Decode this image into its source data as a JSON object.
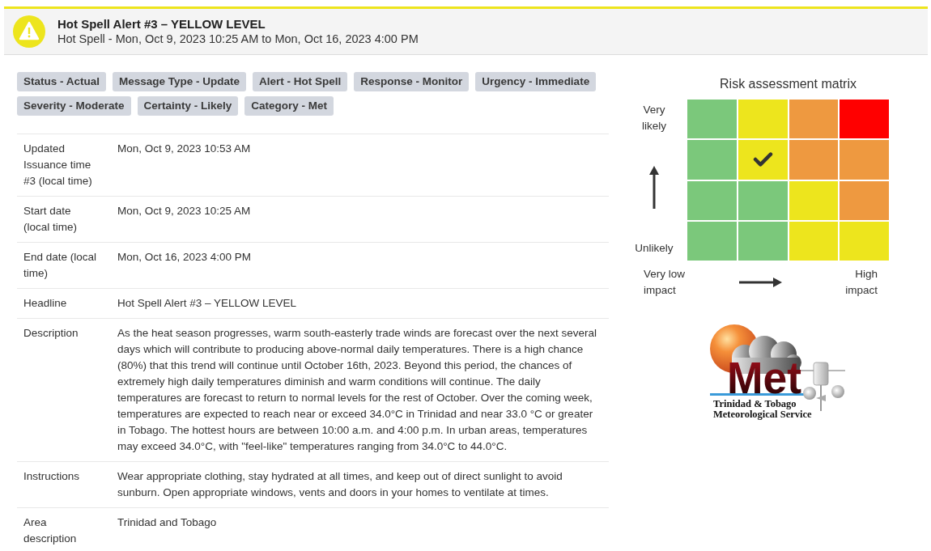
{
  "alert": {
    "title": "Hot Spell Alert #3 – YELLOW LEVEL",
    "subtitle": "Hot Spell - Mon, Oct 9, 2023 10:25 AM to Mon, Oct 16, 2023 4:00 PM"
  },
  "tags": [
    "Status - Actual",
    "Message Type - Update",
    "Alert - Hot Spell",
    "Response - Monitor",
    "Urgency - Immediate",
    "Severity - Moderate",
    "Certainty - Likely",
    "Category - Met"
  ],
  "details": [
    {
      "label": "Updated Issuance time #3 (local time)",
      "value": "Mon, Oct 9, 2023 10:53 AM"
    },
    {
      "label": "Start date (local time)",
      "value": "Mon, Oct 9, 2023 10:25 AM"
    },
    {
      "label": "End date (local time)",
      "value": "Mon, Oct 16, 2023 4:00 PM"
    },
    {
      "label": "Headline",
      "value": "Hot Spell Alert #3 – YELLOW LEVEL"
    },
    {
      "label": "Description",
      "value": "As the heat season progresses, warm south-easterly trade winds are forecast over the next several days which will contribute to producing above-normal daily temperatures. There is a high chance (80%) that this trend will continue until October 16th, 2023. Beyond this period, the chances of extremely high daily temperatures diminish and warm conditions will continue. The daily temperatures are forecast to return to normal levels for the rest of October. Over the coming week, temperatures are expected to reach near or exceed 34.0°C in Trinidad and near 33.0 °C or greater in Tobago. The hottest hours are between 10:00 a.m. and 4:00 p.m. In urban areas, temperatures may exceed 34.0°C, with \"feel-like\" temperatures ranging from 34.0°C to 44.0°C."
    },
    {
      "label": "Instructions",
      "value": "Wear appropriate clothing, stay hydrated at all times, and keep out of direct sunlight to avoid sunburn. Open appropriate windows, vents and doors in your homes to ventilate at times."
    },
    {
      "label": "Area description",
      "value": "Trinidad and Tobago"
    }
  ],
  "risk_matrix": {
    "title": "Risk assessment matrix",
    "likelihood_high_label": "Very likely",
    "likelihood_low_label": "Unlikely",
    "impact_low_label": "Very low impact",
    "impact_high_label": "High impact",
    "rows": [
      {
        "cells": [
          {
            "color": "#7bc87b",
            "selected": false
          },
          {
            "color": "#ede51d",
            "selected": false
          },
          {
            "color": "#ee9940",
            "selected": false
          },
          {
            "color": "#ff0000",
            "selected": false
          }
        ]
      },
      {
        "cells": [
          {
            "color": "#7bc87b",
            "selected": false
          },
          {
            "color": "#ede51d",
            "selected": true
          },
          {
            "color": "#ee9940",
            "selected": false
          },
          {
            "color": "#ee9940",
            "selected": false
          }
        ]
      },
      {
        "cells": [
          {
            "color": "#7bc87b",
            "selected": false
          },
          {
            "color": "#7bc87b",
            "selected": false
          },
          {
            "color": "#ede51d",
            "selected": false
          },
          {
            "color": "#ee9940",
            "selected": false
          }
        ]
      },
      {
        "cells": [
          {
            "color": "#7bc87b",
            "selected": false
          },
          {
            "color": "#7bc87b",
            "selected": false
          },
          {
            "color": "#ede51d",
            "selected": false
          },
          {
            "color": "#ede51d",
            "selected": false
          }
        ]
      }
    ]
  },
  "logo": {
    "wordmark": "Met",
    "caption": [
      "Trinidad & Tobago",
      "Meteorological Service"
    ]
  }
}
